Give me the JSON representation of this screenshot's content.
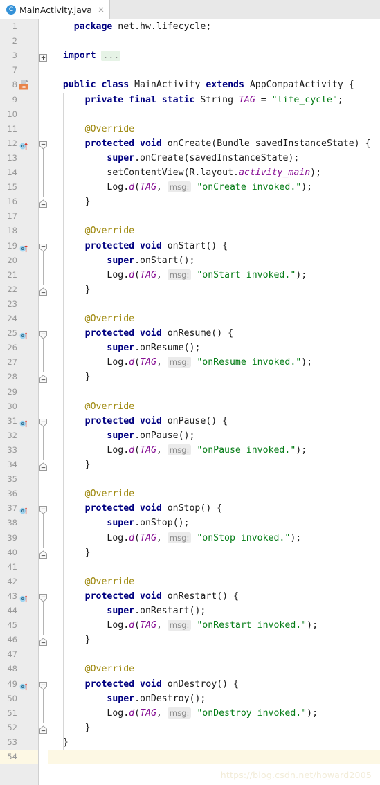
{
  "window": {
    "app": "Android Studio Editor"
  },
  "tabbar": {
    "tabs": [
      {
        "label": "MainActivity.java",
        "icon": "java-class-icon",
        "icon_letter": "C",
        "close_glyph": "×",
        "active": true
      }
    ]
  },
  "editor": {
    "language": "java",
    "current_line": 54,
    "fold_placeholder": "...",
    "colors": {
      "keyword": "#000080",
      "string": "#067d17",
      "field": "#871094",
      "annotation": "#9e880d",
      "plain": "#1a1a1a",
      "hint_text": "#8c8c8c",
      "hint_bg": "#ebebeb",
      "gutter_bg": "#ececec",
      "line_number": "#999999",
      "current_line_bg": "#fdf8e4",
      "editor_bg": "#ffffff",
      "tab_bar_bg": "#e8e8e8",
      "android_marker": "#e8834a",
      "override_marker": "#5aaee0"
    },
    "lines": [
      {
        "num": 1,
        "marker": null,
        "fold": null,
        "tokens": [
          {
            "t": "    ",
            "c": "plain"
          },
          {
            "t": "package",
            "c": "kw"
          },
          {
            "t": " net.hw.lifecycle;",
            "c": "plain"
          }
        ]
      },
      {
        "num": 2,
        "marker": null,
        "fold": null,
        "tokens": []
      },
      {
        "num": 3,
        "marker": null,
        "fold": "plus",
        "tokens": [
          {
            "t": "  ",
            "c": "plain"
          },
          {
            "t": "import",
            "c": "kw"
          },
          {
            "t": " ",
            "c": "plain"
          },
          {
            "t": "...",
            "c": "foldph"
          }
        ]
      },
      {
        "num": 7,
        "marker": null,
        "fold": null,
        "tokens": []
      },
      {
        "num": 8,
        "marker": "android-resource-icon",
        "fold": null,
        "tokens": [
          {
            "t": "  ",
            "c": "plain"
          },
          {
            "t": "public class",
            "c": "kw"
          },
          {
            "t": " MainActivity ",
            "c": "plain"
          },
          {
            "t": "extends",
            "c": "kw"
          },
          {
            "t": " AppCompatActivity {",
            "c": "plain"
          }
        ]
      },
      {
        "num": 9,
        "marker": null,
        "fold": null,
        "tokens": [
          {
            "t": "      ",
            "c": "plain"
          },
          {
            "t": "private final static",
            "c": "kw"
          },
          {
            "t": " String ",
            "c": "plain"
          },
          {
            "t": "TAG",
            "c": "fld"
          },
          {
            "t": " = ",
            "c": "plain"
          },
          {
            "t": "\"life_cycle\"",
            "c": "str"
          },
          {
            "t": ";",
            "c": "plain"
          }
        ]
      },
      {
        "num": 10,
        "marker": null,
        "fold": null,
        "tokens": []
      },
      {
        "num": 11,
        "marker": null,
        "fold": null,
        "tokens": [
          {
            "t": "      ",
            "c": "plain"
          },
          {
            "t": "@Override",
            "c": "ann"
          }
        ]
      },
      {
        "num": 12,
        "marker": "override-method-icon",
        "fold": "minus-top",
        "tokens": [
          {
            "t": "      ",
            "c": "plain"
          },
          {
            "t": "protected void",
            "c": "kw"
          },
          {
            "t": " onCreate(Bundle savedInstanceState) {",
            "c": "plain"
          }
        ]
      },
      {
        "num": 13,
        "marker": null,
        "fold": null,
        "tokens": [
          {
            "t": "          ",
            "c": "plain"
          },
          {
            "t": "super",
            "c": "kw"
          },
          {
            "t": ".onCreate(savedInstanceState);",
            "c": "plain"
          }
        ]
      },
      {
        "num": 14,
        "marker": null,
        "fold": null,
        "tokens": [
          {
            "t": "          setContentView(R.layout.",
            "c": "plain"
          },
          {
            "t": "activity_main",
            "c": "fld"
          },
          {
            "t": ");",
            "c": "plain"
          }
        ]
      },
      {
        "num": 15,
        "marker": null,
        "fold": null,
        "tokens": [
          {
            "t": "          Log.",
            "c": "plain"
          },
          {
            "t": "d",
            "c": "fld"
          },
          {
            "t": "(",
            "c": "plain"
          },
          {
            "t": "TAG",
            "c": "fld"
          },
          {
            "t": ", ",
            "c": "plain"
          },
          {
            "t": "msg:",
            "c": "hint"
          },
          {
            "t": " ",
            "c": "plain"
          },
          {
            "t": "\"onCreate invoked.\"",
            "c": "str"
          },
          {
            "t": ");",
            "c": "plain"
          }
        ]
      },
      {
        "num": 16,
        "marker": null,
        "fold": "minus-bottom",
        "tokens": [
          {
            "t": "      }",
            "c": "plain"
          }
        ]
      },
      {
        "num": 17,
        "marker": null,
        "fold": null,
        "tokens": []
      },
      {
        "num": 18,
        "marker": null,
        "fold": null,
        "tokens": [
          {
            "t": "      ",
            "c": "plain"
          },
          {
            "t": "@Override",
            "c": "ann"
          }
        ]
      },
      {
        "num": 19,
        "marker": "override-method-icon",
        "fold": "minus-top",
        "tokens": [
          {
            "t": "      ",
            "c": "plain"
          },
          {
            "t": "protected void",
            "c": "kw"
          },
          {
            "t": " onStart() {",
            "c": "plain"
          }
        ]
      },
      {
        "num": 20,
        "marker": null,
        "fold": null,
        "tokens": [
          {
            "t": "          ",
            "c": "plain"
          },
          {
            "t": "super",
            "c": "kw"
          },
          {
            "t": ".onStart();",
            "c": "plain"
          }
        ]
      },
      {
        "num": 21,
        "marker": null,
        "fold": null,
        "tokens": [
          {
            "t": "          Log.",
            "c": "plain"
          },
          {
            "t": "d",
            "c": "fld"
          },
          {
            "t": "(",
            "c": "plain"
          },
          {
            "t": "TAG",
            "c": "fld"
          },
          {
            "t": ", ",
            "c": "plain"
          },
          {
            "t": "msg:",
            "c": "hint"
          },
          {
            "t": " ",
            "c": "plain"
          },
          {
            "t": "\"onStart invoked.\"",
            "c": "str"
          },
          {
            "t": ");",
            "c": "plain"
          }
        ]
      },
      {
        "num": 22,
        "marker": null,
        "fold": "minus-bottom",
        "tokens": [
          {
            "t": "      }",
            "c": "plain"
          }
        ]
      },
      {
        "num": 23,
        "marker": null,
        "fold": null,
        "tokens": []
      },
      {
        "num": 24,
        "marker": null,
        "fold": null,
        "tokens": [
          {
            "t": "      ",
            "c": "plain"
          },
          {
            "t": "@Override",
            "c": "ann"
          }
        ]
      },
      {
        "num": 25,
        "marker": "override-method-icon",
        "fold": "minus-top",
        "tokens": [
          {
            "t": "      ",
            "c": "plain"
          },
          {
            "t": "protected void",
            "c": "kw"
          },
          {
            "t": " onResume() {",
            "c": "plain"
          }
        ]
      },
      {
        "num": 26,
        "marker": null,
        "fold": null,
        "tokens": [
          {
            "t": "          ",
            "c": "plain"
          },
          {
            "t": "super",
            "c": "kw"
          },
          {
            "t": ".onResume();",
            "c": "plain"
          }
        ]
      },
      {
        "num": 27,
        "marker": null,
        "fold": null,
        "tokens": [
          {
            "t": "          Log.",
            "c": "plain"
          },
          {
            "t": "d",
            "c": "fld"
          },
          {
            "t": "(",
            "c": "plain"
          },
          {
            "t": "TAG",
            "c": "fld"
          },
          {
            "t": ", ",
            "c": "plain"
          },
          {
            "t": "msg:",
            "c": "hint"
          },
          {
            "t": " ",
            "c": "plain"
          },
          {
            "t": "\"onResume invoked.\"",
            "c": "str"
          },
          {
            "t": ");",
            "c": "plain"
          }
        ]
      },
      {
        "num": 28,
        "marker": null,
        "fold": "minus-bottom",
        "tokens": [
          {
            "t": "      }",
            "c": "plain"
          }
        ]
      },
      {
        "num": 29,
        "marker": null,
        "fold": null,
        "tokens": []
      },
      {
        "num": 30,
        "marker": null,
        "fold": null,
        "tokens": [
          {
            "t": "      ",
            "c": "plain"
          },
          {
            "t": "@Override",
            "c": "ann"
          }
        ]
      },
      {
        "num": 31,
        "marker": "override-method-icon",
        "fold": "minus-top",
        "tokens": [
          {
            "t": "      ",
            "c": "plain"
          },
          {
            "t": "protected void",
            "c": "kw"
          },
          {
            "t": " onPause() {",
            "c": "plain"
          }
        ]
      },
      {
        "num": 32,
        "marker": null,
        "fold": null,
        "tokens": [
          {
            "t": "          ",
            "c": "plain"
          },
          {
            "t": "super",
            "c": "kw"
          },
          {
            "t": ".onPause();",
            "c": "plain"
          }
        ]
      },
      {
        "num": 33,
        "marker": null,
        "fold": null,
        "tokens": [
          {
            "t": "          Log.",
            "c": "plain"
          },
          {
            "t": "d",
            "c": "fld"
          },
          {
            "t": "(",
            "c": "plain"
          },
          {
            "t": "TAG",
            "c": "fld"
          },
          {
            "t": ", ",
            "c": "plain"
          },
          {
            "t": "msg:",
            "c": "hint"
          },
          {
            "t": " ",
            "c": "plain"
          },
          {
            "t": "\"onPause invoked.\"",
            "c": "str"
          },
          {
            "t": ");",
            "c": "plain"
          }
        ]
      },
      {
        "num": 34,
        "marker": null,
        "fold": "minus-bottom",
        "tokens": [
          {
            "t": "      }",
            "c": "plain"
          }
        ]
      },
      {
        "num": 35,
        "marker": null,
        "fold": null,
        "tokens": []
      },
      {
        "num": 36,
        "marker": null,
        "fold": null,
        "tokens": [
          {
            "t": "      ",
            "c": "plain"
          },
          {
            "t": "@Override",
            "c": "ann"
          }
        ]
      },
      {
        "num": 37,
        "marker": "override-method-icon",
        "fold": "minus-top",
        "tokens": [
          {
            "t": "      ",
            "c": "plain"
          },
          {
            "t": "protected void",
            "c": "kw"
          },
          {
            "t": " onStop() {",
            "c": "plain"
          }
        ]
      },
      {
        "num": 38,
        "marker": null,
        "fold": null,
        "tokens": [
          {
            "t": "          ",
            "c": "plain"
          },
          {
            "t": "super",
            "c": "kw"
          },
          {
            "t": ".onStop();",
            "c": "plain"
          }
        ]
      },
      {
        "num": 39,
        "marker": null,
        "fold": null,
        "tokens": [
          {
            "t": "          Log.",
            "c": "plain"
          },
          {
            "t": "d",
            "c": "fld"
          },
          {
            "t": "(",
            "c": "plain"
          },
          {
            "t": "TAG",
            "c": "fld"
          },
          {
            "t": ", ",
            "c": "plain"
          },
          {
            "t": "msg:",
            "c": "hint"
          },
          {
            "t": " ",
            "c": "plain"
          },
          {
            "t": "\"onStop invoked.\"",
            "c": "str"
          },
          {
            "t": ");",
            "c": "plain"
          }
        ]
      },
      {
        "num": 40,
        "marker": null,
        "fold": "minus-bottom",
        "tokens": [
          {
            "t": "      }",
            "c": "plain"
          }
        ]
      },
      {
        "num": 41,
        "marker": null,
        "fold": null,
        "tokens": []
      },
      {
        "num": 42,
        "marker": null,
        "fold": null,
        "tokens": [
          {
            "t": "      ",
            "c": "plain"
          },
          {
            "t": "@Override",
            "c": "ann"
          }
        ]
      },
      {
        "num": 43,
        "marker": "override-method-icon",
        "fold": "minus-top",
        "tokens": [
          {
            "t": "      ",
            "c": "plain"
          },
          {
            "t": "protected void",
            "c": "kw"
          },
          {
            "t": " onRestart() {",
            "c": "plain"
          }
        ]
      },
      {
        "num": 44,
        "marker": null,
        "fold": null,
        "tokens": [
          {
            "t": "          ",
            "c": "plain"
          },
          {
            "t": "super",
            "c": "kw"
          },
          {
            "t": ".onRestart();",
            "c": "plain"
          }
        ]
      },
      {
        "num": 45,
        "marker": null,
        "fold": null,
        "tokens": [
          {
            "t": "          Log.",
            "c": "plain"
          },
          {
            "t": "d",
            "c": "fld"
          },
          {
            "t": "(",
            "c": "plain"
          },
          {
            "t": "TAG",
            "c": "fld"
          },
          {
            "t": ", ",
            "c": "plain"
          },
          {
            "t": "msg:",
            "c": "hint"
          },
          {
            "t": " ",
            "c": "plain"
          },
          {
            "t": "\"onRestart invoked.\"",
            "c": "str"
          },
          {
            "t": ");",
            "c": "plain"
          }
        ]
      },
      {
        "num": 46,
        "marker": null,
        "fold": "minus-bottom",
        "tokens": [
          {
            "t": "      }",
            "c": "plain"
          }
        ]
      },
      {
        "num": 47,
        "marker": null,
        "fold": null,
        "tokens": []
      },
      {
        "num": 48,
        "marker": null,
        "fold": null,
        "tokens": [
          {
            "t": "      ",
            "c": "plain"
          },
          {
            "t": "@Override",
            "c": "ann"
          }
        ]
      },
      {
        "num": 49,
        "marker": "override-method-icon",
        "fold": "minus-top",
        "tokens": [
          {
            "t": "      ",
            "c": "plain"
          },
          {
            "t": "protected void",
            "c": "kw"
          },
          {
            "t": " onDestroy() {",
            "c": "plain"
          }
        ]
      },
      {
        "num": 50,
        "marker": null,
        "fold": null,
        "tokens": [
          {
            "t": "          ",
            "c": "plain"
          },
          {
            "t": "super",
            "c": "kw"
          },
          {
            "t": ".onDestroy();",
            "c": "plain"
          }
        ]
      },
      {
        "num": 51,
        "marker": null,
        "fold": null,
        "tokens": [
          {
            "t": "          Log.",
            "c": "plain"
          },
          {
            "t": "d",
            "c": "fld"
          },
          {
            "t": "(",
            "c": "plain"
          },
          {
            "t": "TAG",
            "c": "fld"
          },
          {
            "t": ", ",
            "c": "plain"
          },
          {
            "t": "msg:",
            "c": "hint"
          },
          {
            "t": " ",
            "c": "plain"
          },
          {
            "t": "\"onDestroy invoked.\"",
            "c": "str"
          },
          {
            "t": ");",
            "c": "plain"
          }
        ]
      },
      {
        "num": 52,
        "marker": null,
        "fold": "minus-bottom",
        "tokens": [
          {
            "t": "      }",
            "c": "plain"
          }
        ]
      },
      {
        "num": 53,
        "marker": null,
        "fold": null,
        "tokens": [
          {
            "t": "  }",
            "c": "plain"
          }
        ]
      },
      {
        "num": 54,
        "marker": null,
        "fold": null,
        "tokens": []
      }
    ]
  },
  "watermark": {
    "text": "https://blog.csdn.net/howard2005"
  }
}
